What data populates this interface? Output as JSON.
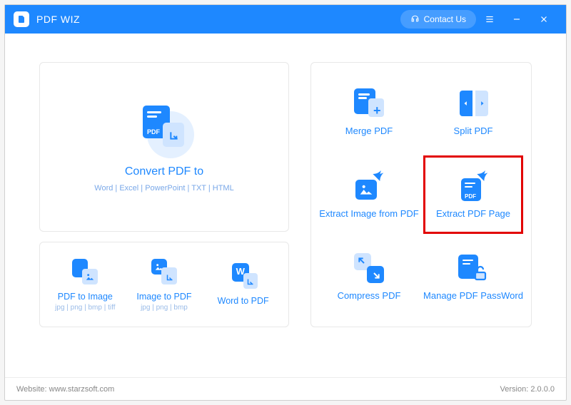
{
  "app": {
    "title": "PDF WIZ"
  },
  "titlebar": {
    "contact": "Contact Us"
  },
  "convert": {
    "title": "Convert PDF to",
    "formats": "Word | Excel | PowerPoint | TXT | HTML"
  },
  "miniTools": [
    {
      "label": "PDF to Image",
      "sub": "jpg | png | bmp | tiff"
    },
    {
      "label": "Image to PDF",
      "sub": "jpg | png | bmp"
    },
    {
      "label": "Word to PDF",
      "sub": ""
    }
  ],
  "tiles": [
    {
      "label": "Merge PDF"
    },
    {
      "label": "Split PDF"
    },
    {
      "label": "Extract Image from PDF"
    },
    {
      "label": "Extract PDF Page"
    },
    {
      "label": "Compress PDF"
    },
    {
      "label": "Manage PDF PassWord"
    }
  ],
  "footer": {
    "website_label": "Website:",
    "website": "www.starzsoft.com",
    "version_label": "Version:",
    "version": "2.0.0.0"
  }
}
